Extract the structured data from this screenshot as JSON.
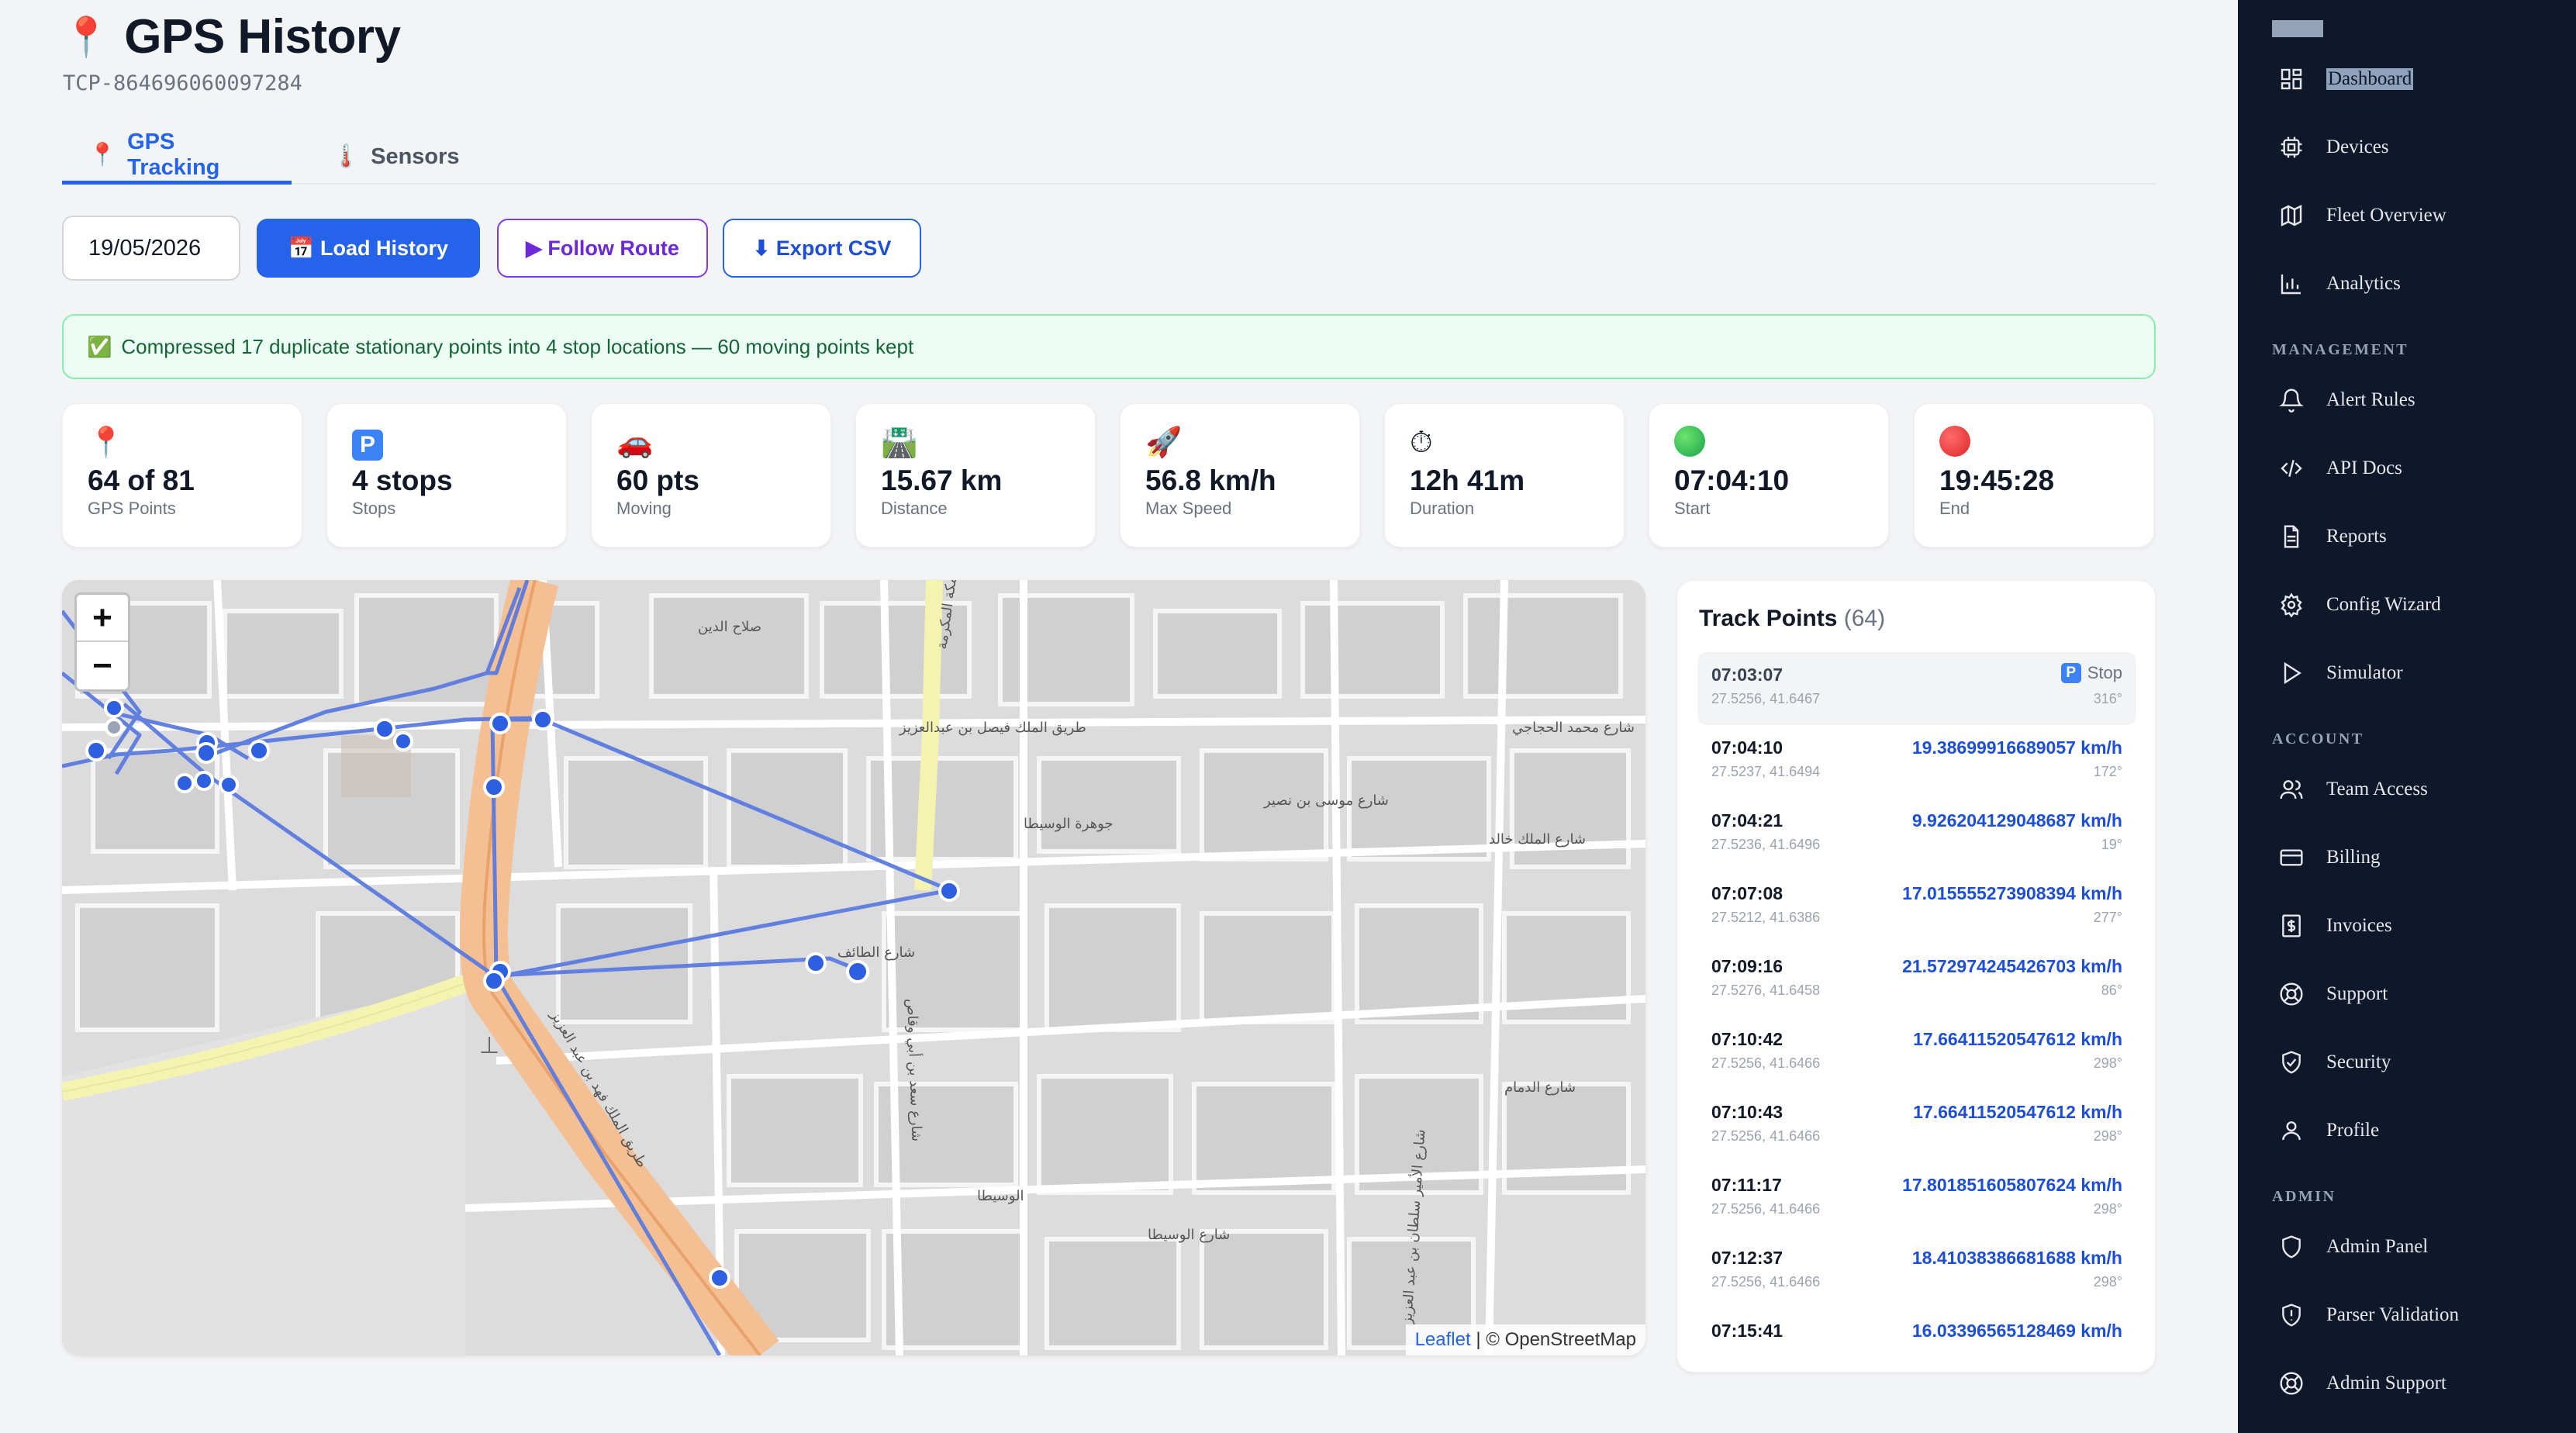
{
  "page": {
    "icon": "📍",
    "title": "GPS History",
    "device_id": "TCP-864696060097284"
  },
  "tabs": [
    {
      "icon": "📍",
      "label": "GPS Tracking",
      "active": true
    },
    {
      "icon": "🌡️",
      "label": "Sensors",
      "active": false
    }
  ],
  "toolbar": {
    "date_value": "19/05/2026",
    "load_label": "📅 Load History",
    "follow_label": "▶ Follow Route",
    "export_label": "⬇ Export CSV"
  },
  "notice": {
    "icon": "✅",
    "text": "Compressed 17 duplicate stationary points into 4 stop locations — 60 moving points kept"
  },
  "stats": [
    {
      "icon": "📍",
      "value": "64 of 81",
      "label": "GPS Points"
    },
    {
      "icon": "P",
      "value": "4 stops",
      "label": "Stops"
    },
    {
      "icon": "🚗",
      "value": "60 pts",
      "label": "Moving"
    },
    {
      "icon": "🛣️",
      "value": "15.67 km",
      "label": "Distance"
    },
    {
      "icon": "🚀",
      "value": "56.8 km/h",
      "label": "Max Speed"
    },
    {
      "icon": "⏱",
      "value": "12h 41m",
      "label": "Duration"
    },
    {
      "icon": "green-dot",
      "value": "07:04:10",
      "label": "Start"
    },
    {
      "icon": "red-dot",
      "value": "19:45:28",
      "label": "End"
    }
  ],
  "map": {
    "zoom_in": "+",
    "zoom_out": "−",
    "attribution_leaflet": "Leaflet",
    "attribution_rest": "| © OpenStreetMap",
    "street_labels": [
      "صلاح الدين",
      "طريق الملك فيصل بن عبدالعزيز",
      "جوهرة الوسيطا",
      "شارع الطائف",
      "شارع موسى بن نصير",
      "شارع الملك خالد",
      "شارع محمد الحجاجي",
      "الوسيطا",
      "شارع الوسيطا",
      "طريق الملك فهد بن عبد العزيز",
      "طريق مكة المكرمة",
      "شارع سعد بن أبي وقاص",
      "شارع الدمام",
      "شارع الأمير سلطان بن عبد العزيز"
    ]
  },
  "track": {
    "title": "Track Points",
    "count": "(64)",
    "points": [
      {
        "time": "07:03:07",
        "coord": "27.5256, 41.6467",
        "stop": true,
        "stop_label": "Stop",
        "heading": "316°"
      },
      {
        "time": "07:04:10",
        "coord": "27.5237, 41.6494",
        "speed": "19.38699916689057 km/h",
        "heading": "172°"
      },
      {
        "time": "07:04:21",
        "coord": "27.5236, 41.6496",
        "speed": "9.926204129048687 km/h",
        "heading": "19°"
      },
      {
        "time": "07:07:08",
        "coord": "27.5212, 41.6386",
        "speed": "17.015555273908394 km/h",
        "heading": "277°"
      },
      {
        "time": "07:09:16",
        "coord": "27.5276, 41.6458",
        "speed": "21.572974245426703 km/h",
        "heading": "86°"
      },
      {
        "time": "07:10:42",
        "coord": "27.5256, 41.6466",
        "speed": "17.66411520547612 km/h",
        "heading": "298°"
      },
      {
        "time": "07:10:43",
        "coord": "27.5256, 41.6466",
        "speed": "17.66411520547612 km/h",
        "heading": "298°"
      },
      {
        "time": "07:11:17",
        "coord": "27.5256, 41.6466",
        "speed": "17.801851605807624 km/h",
        "heading": "298°"
      },
      {
        "time": "07:12:37",
        "coord": "27.5256, 41.6466",
        "speed": "18.41038386681688 km/h",
        "heading": "298°"
      },
      {
        "time": "07:15:41",
        "coord": "",
        "speed": "16.03396565128469 km/h",
        "heading": ""
      }
    ]
  },
  "sidebar": {
    "items_main": [
      {
        "label": "Dashboard",
        "icon": "grid-icon",
        "active": true
      },
      {
        "label": "Devices",
        "icon": "chip-icon"
      },
      {
        "label": "Fleet Overview",
        "icon": "map-icon"
      },
      {
        "label": "Analytics",
        "icon": "bar-chart-icon"
      }
    ],
    "section_management": "MANAGEMENT",
    "items_management": [
      {
        "label": "Alert Rules",
        "icon": "bell-icon"
      },
      {
        "label": "API Docs",
        "icon": "code-icon"
      },
      {
        "label": "Reports",
        "icon": "document-icon"
      },
      {
        "label": "Config Wizard",
        "icon": "gear-icon"
      },
      {
        "label": "Simulator",
        "icon": "play-icon"
      }
    ],
    "section_account": "ACCOUNT",
    "items_account": [
      {
        "label": "Team Access",
        "icon": "users-icon"
      },
      {
        "label": "Billing",
        "icon": "credit-card-icon"
      },
      {
        "label": "Invoices",
        "icon": "dollar-icon"
      },
      {
        "label": "Support",
        "icon": "lifebuoy-icon"
      },
      {
        "label": "Security",
        "icon": "shield-check-icon"
      },
      {
        "label": "Profile",
        "icon": "user-icon"
      }
    ],
    "section_admin": "ADMIN",
    "items_admin": [
      {
        "label": "Admin Panel",
        "icon": "shield-icon"
      },
      {
        "label": "Parser Validation",
        "icon": "alert-shield-icon"
      },
      {
        "label": "Admin Support",
        "icon": "lifebuoy-icon"
      }
    ]
  }
}
